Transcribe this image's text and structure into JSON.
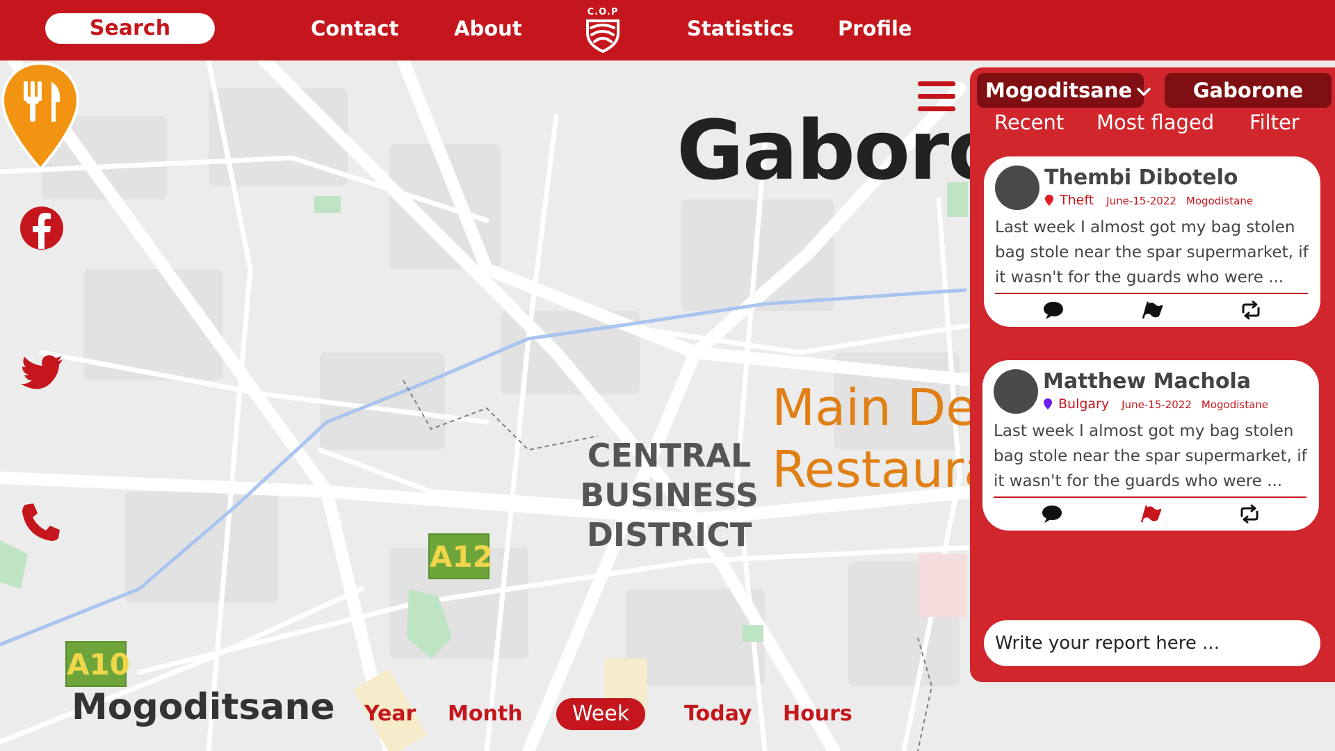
{
  "nav": {
    "search_label": "Search",
    "links": [
      "Contact",
      "About",
      "Statistics",
      "Profile"
    ],
    "logo_text": "C.O.P"
  },
  "map": {
    "city_label": "Gaborone",
    "district_label": [
      "CENTRAL",
      "BUSINESS",
      "DISTRICT"
    ],
    "poi_label": [
      "Main Deck",
      "Restaurant"
    ],
    "roads": [
      "A12",
      "A10"
    ],
    "area_label": "Mogoditsane"
  },
  "social": [
    "facebook-icon",
    "twitter-icon",
    "phone-icon"
  ],
  "time_filter": {
    "options": [
      "Year",
      "Month",
      "Week",
      "Today",
      "Hours"
    ],
    "selected": "Week"
  },
  "panel": {
    "location_current": "Mogoditsane",
    "location_alt": "Gaborone",
    "tabs": [
      "Recent",
      "Most flaged",
      "Filter"
    ],
    "reports": [
      {
        "name": "Thembi Dibotelo",
        "category": "Theft",
        "category_color": "#e31c23",
        "date": "June-15-2022",
        "place": "Mogodistane",
        "text": "Last week I almost got my bag stolen bag stole near the spar supermarket, if it wasn't for the guards who were ...",
        "flagged": false
      },
      {
        "name": "Matthew Machola",
        "category": "Bulgary",
        "category_color": "#6a1ee8",
        "date": "June-15-2022",
        "place": "Mogodistane",
        "text": "Last week I almost got my bag stolen bag stole near the spar supermarket, if it wasn't for the guards who were ...",
        "flagged": true
      }
    ],
    "report_placeholder": "Write your report here ..."
  },
  "colors": {
    "brand_red": "#c4161c",
    "panel_red": "#d0262c",
    "dark_red": "#7f0f12",
    "poi_orange": "#e07f14"
  }
}
